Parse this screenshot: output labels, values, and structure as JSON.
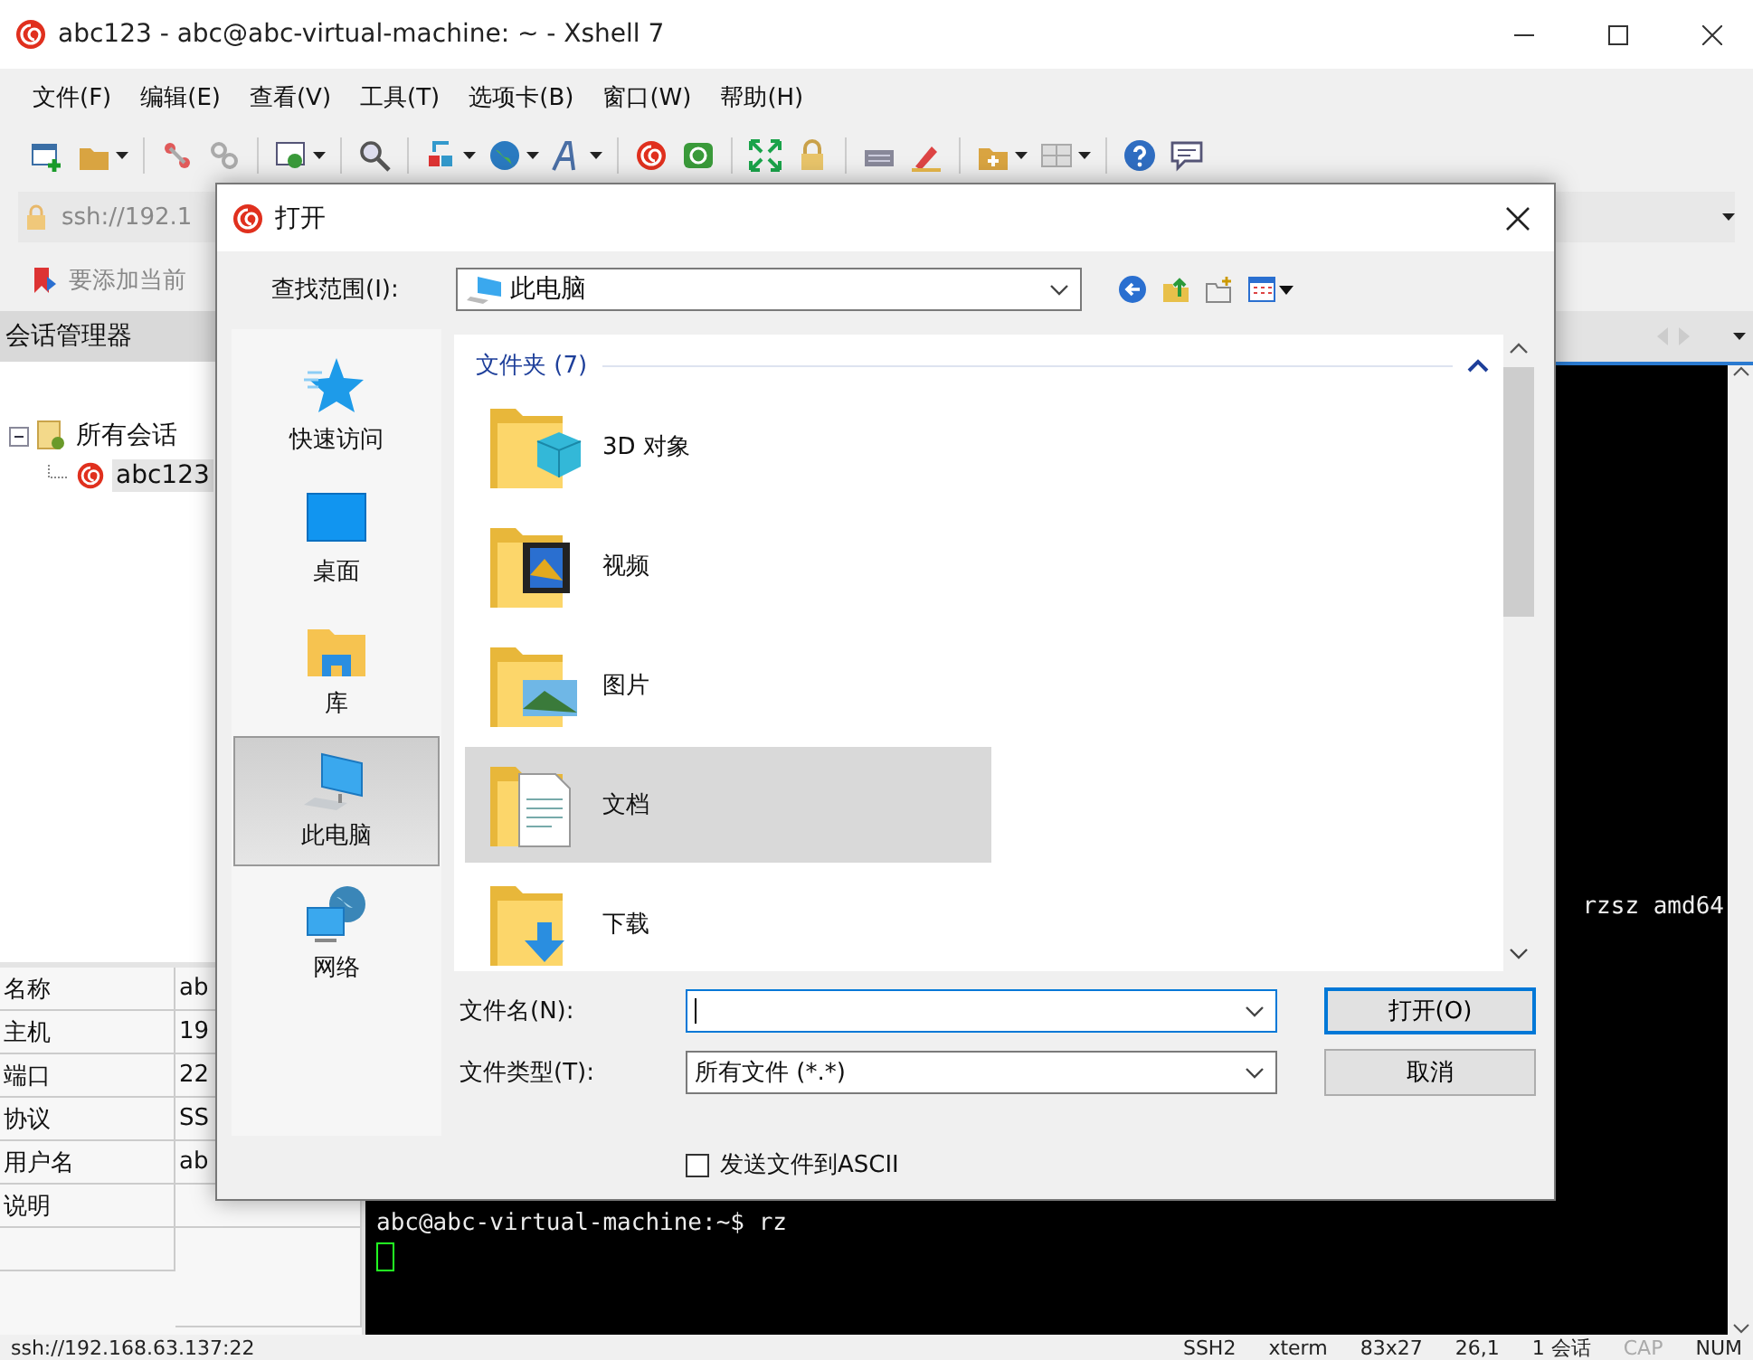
{
  "window": {
    "title": "abc123 - abc@abc-virtual-machine: ~ - Xshell 7"
  },
  "menu": [
    "文件(F)",
    "编辑(E)",
    "查看(V)",
    "工具(T)",
    "选项卡(B)",
    "窗口(W)",
    "帮助(H)"
  ],
  "address_bar": {
    "value": "ssh://192.1"
  },
  "link_bar": {
    "text": "要添加当前"
  },
  "session_manager": {
    "title": "会话管理器",
    "tree": [
      {
        "label": "所有会话",
        "expanded": true,
        "selected": false,
        "children": [
          {
            "label": "abc123",
            "selected": true
          }
        ]
      }
    ],
    "properties": [
      {
        "name": "名称",
        "value": "ab"
      },
      {
        "name": "主机",
        "value": "19"
      },
      {
        "name": "端口",
        "value": "22"
      },
      {
        "name": "协议",
        "value": "SS"
      },
      {
        "name": "用户名",
        "value": "ab"
      },
      {
        "name": "说明"
      }
    ]
  },
  "terminal": {
    "lines": [
      "rzsz amd64",
      "abc@abc-virtual-machine:~$ rz"
    ]
  },
  "dialog": {
    "title": "打开",
    "look_in_label": "查找范围(I):",
    "look_in_value": "此电脑",
    "places": [
      {
        "label": "快速访问",
        "selected": false
      },
      {
        "label": "桌面",
        "selected": false
      },
      {
        "label": "库",
        "selected": false
      },
      {
        "label": "此电脑",
        "selected": true
      },
      {
        "label": "网络",
        "selected": false
      }
    ],
    "group": {
      "label": "文件夹 (7)",
      "expanded": true
    },
    "items": [
      {
        "label": "3D 对象",
        "selected": false
      },
      {
        "label": "视频",
        "selected": false
      },
      {
        "label": "图片",
        "selected": false
      },
      {
        "label": "文档",
        "selected": true
      },
      {
        "label": "下载",
        "selected": false
      }
    ],
    "filename_label": "文件名(N):",
    "filetype_label": "文件类型(T):",
    "filetype_value": "所有文件 (*.*)",
    "buttons": [
      "打开(O)",
      "取消"
    ],
    "ascii_checkbox": {
      "label": "发送文件到ASCII",
      "checked": false
    }
  },
  "status_bar": {
    "address": "ssh://192.168.63.137:22",
    "items": [
      "SSH2",
      "xterm",
      "83x27",
      "26,1",
      "1 会话"
    ],
    "indicators": [
      {
        "label": "CAP",
        "on": false
      },
      {
        "label": "NUM",
        "on": true
      }
    ]
  }
}
